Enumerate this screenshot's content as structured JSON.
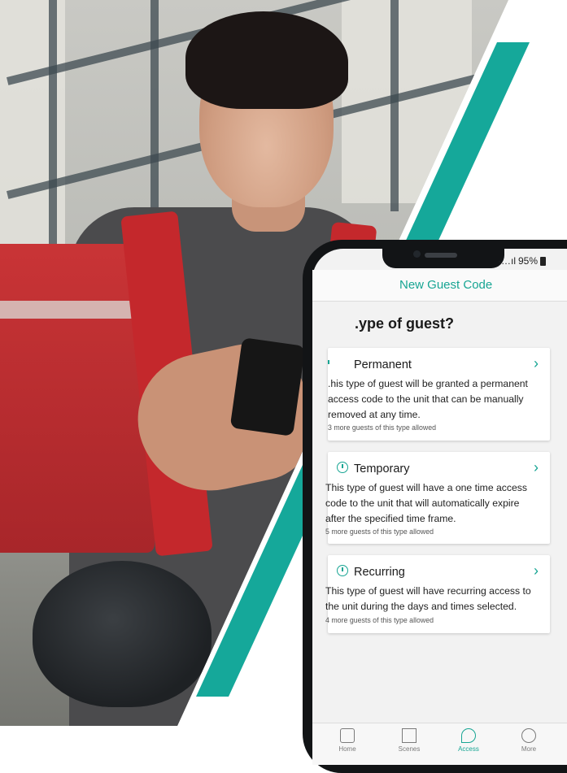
{
  "colors": {
    "teal": "#15a89a",
    "accent": "#17a593"
  },
  "status_bar": {
    "signal": "·…ıl",
    "battery": "95%"
  },
  "header": {
    "title": "New Guest Code"
  },
  "question": ".ype of guest?",
  "cards": [
    {
      "title": "Permanent",
      "icon": "permanent-icon",
      "description": ".his type of guest will be granted a permanent access code to the unit that can be manually removed at any time.",
      "note": "3 more guests of this type allowed"
    },
    {
      "title": "Temporary",
      "icon": "timer-icon",
      "description": "This type of guest will have a one time access code to the unit that will automatically expire after the specified time frame.",
      "note": "5 more guests of this type allowed"
    },
    {
      "title": "Recurring",
      "icon": "recurring-clock-icon",
      "description": "This type of guest will have recurring access to the unit during the days and times selected.",
      "note": "4 more guests of this type allowed"
    }
  ],
  "nav": [
    {
      "label": "Home",
      "icon": "home-icon",
      "active": false
    },
    {
      "label": "Scenes",
      "icon": "scenes-icon",
      "active": false
    },
    {
      "label": "Access",
      "icon": "key-icon",
      "active": true
    },
    {
      "label": "More",
      "icon": "more-icon",
      "active": false
    }
  ]
}
